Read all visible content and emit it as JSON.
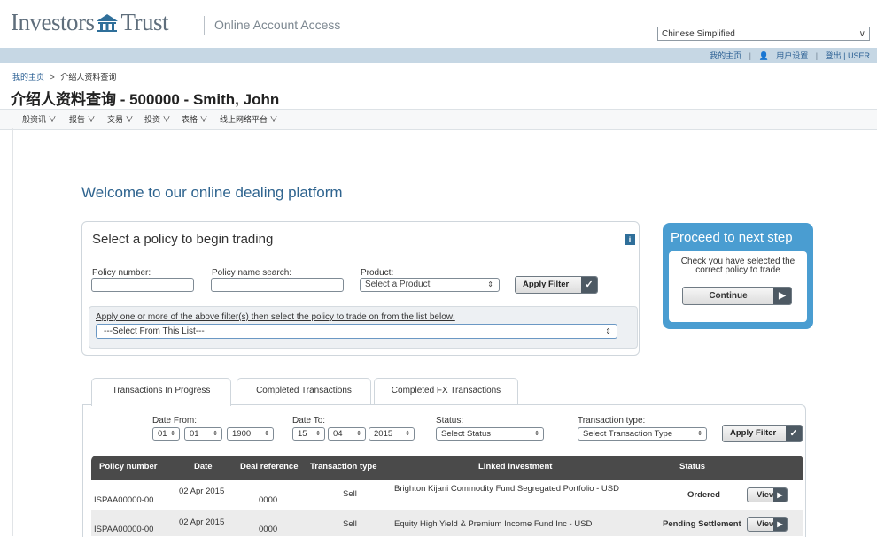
{
  "header": {
    "logo_part1": "Investors",
    "logo_part2": "Trust",
    "site_title": "Online Account Access",
    "language": "Chinese Simplified",
    "top_links": [
      "我的主页",
      "用户设置",
      "登出 | USER"
    ]
  },
  "breadcrumb": {
    "home": "我的主页",
    "separator": ">",
    "current": "介绍人资料查询"
  },
  "page_title": "介绍人资料查询 - 500000 - Smith, John",
  "menu": [
    "一般资讯 ∨",
    "报告 ∨",
    "交易 ∨",
    "投资 ∨",
    "表格 ∨",
    "线上网络平台 ∨"
  ],
  "welcome": "Welcome to our online dealing platform",
  "policy_panel": {
    "heading": "Select a policy to begin trading",
    "info_icon": "i",
    "policy_number_label": "Policy number:",
    "policy_number_value": "",
    "policy_name_label": "Policy name search:",
    "policy_name_value": "",
    "product_label": "Product:",
    "product_value": "Select a Product",
    "apply_filter": "Apply Filter",
    "instruction": "Apply one or more of the above filter(s) then select the policy to trade on from the list below:",
    "list_value": "---Select From This List---"
  },
  "proceed": {
    "heading": "Proceed to next step",
    "text": "Check you have selected the correct policy to trade",
    "button": "Continue"
  },
  "tabs": [
    "Transactions In Progress",
    "Completed Transactions",
    "Completed FX Transactions"
  ],
  "filters": {
    "date_from_label": "Date From:",
    "date_from": [
      "01",
      "01",
      "1900"
    ],
    "date_to_label": "Date To:",
    "date_to": [
      "15",
      "04",
      "2015"
    ],
    "status_label": "Status:",
    "status_value": "Select Status",
    "type_label": "Transaction type:",
    "type_value": "Select Transaction Type",
    "apply_filter": "Apply Filter"
  },
  "table": {
    "headers": [
      "Policy number",
      "Date",
      "Deal reference",
      "Transaction type",
      "Linked investment",
      "Status"
    ],
    "rows": [
      {
        "policy": "ISPAA00000-00",
        "date": "02 Apr 2015",
        "deal": "0000",
        "type": "Sell",
        "investment": "Brighton Kijani Commodity Fund Segregated Portfolio - USD",
        "status": "Ordered",
        "action": "View"
      },
      {
        "policy": "ISPAA00000-00",
        "date": "02 Apr 2015",
        "deal": "0000",
        "type": "Sell",
        "investment": "Equity High Yield & Premium Income Fund Inc - USD",
        "status": "Pending Settlement",
        "action": "View"
      }
    ]
  },
  "colors": {
    "brand_blue": "#2f648f",
    "proceed_blue": "#4a9dd1",
    "table_header": "#4a4a4a",
    "top_bar": "#c6d7e4"
  }
}
